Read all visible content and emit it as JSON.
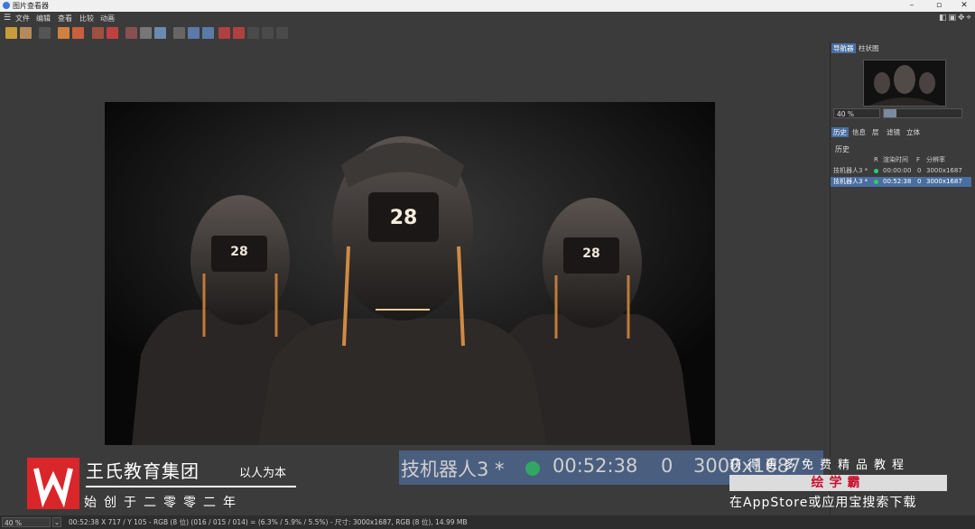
{
  "window": {
    "title": "图片查看器"
  },
  "menu": [
    "文件",
    "编辑",
    "查看",
    "比较",
    "动画"
  ],
  "panel": {
    "tabs_top": [
      "导航器",
      "柱状图"
    ],
    "zoom": "40 %",
    "tabs_mid": [
      "历史",
      "信息",
      "层",
      "滤镜",
      "立体"
    ],
    "history_title": "历史",
    "columns": [
      "R",
      "渲染时间",
      "F",
      "分辨率"
    ],
    "rows": [
      {
        "name": "技机器人3 *",
        "time": "00:00:00",
        "frame": "0",
        "res": "3000x1687"
      },
      {
        "name": "技机器人3 *",
        "time": "00:52:38",
        "frame": "0",
        "res": "3000x1687"
      }
    ]
  },
  "status": {
    "zoom": "40 %",
    "dropdown": "⌄",
    "text": "00:52:38    X 717 / Y 105 - RGB (8 位) (016 / 015 / 014) = (6.3% / 5.9% / 5.5%) - 尺寸: 3000x1687, RGB (8 位), 14.99 MB"
  },
  "render": {
    "badge": "28"
  },
  "overlay": {
    "org_name": "王氏教育集团",
    "slogan": "以人为本",
    "founded": "始创于二零零二年",
    "zoom_name": "技机器人3 *",
    "zoom_time": "00:52:38",
    "zoom_frame": "0",
    "zoom_res": "3000x1687",
    "promo_line1": "获得更多免费精品教程",
    "promo_brand": "绘学霸",
    "promo_line3": "在AppStore或应用宝搜索下载"
  },
  "colors": {
    "accent": "#4a6ea0",
    "status_dot": "#2ecc71",
    "logo_red": "#d9262a"
  }
}
